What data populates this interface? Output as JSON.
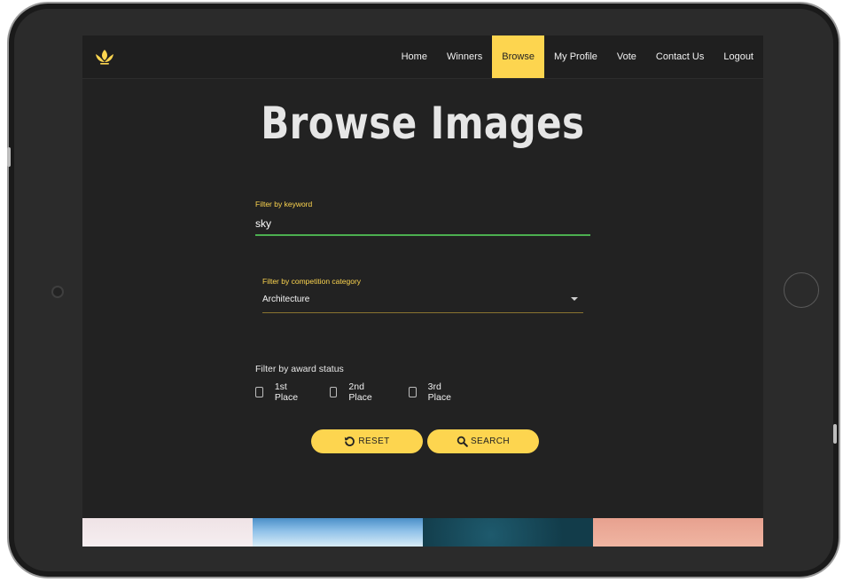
{
  "nav": {
    "logo_icon": "lotus-icon",
    "items": [
      "Home",
      "Winners",
      "Browse",
      "My Profile",
      "Vote",
      "Contact Us",
      "Logout"
    ],
    "active": "Browse"
  },
  "page": {
    "title": "Browse Images"
  },
  "filters": {
    "keyword": {
      "label": "Filter by keyword",
      "value": "sky"
    },
    "category": {
      "label": "Filter by competition category",
      "value": "Architecture"
    },
    "award": {
      "label": "Filter by award status",
      "options": [
        {
          "label": "1st Place",
          "checked": false
        },
        {
          "label": "2nd Place",
          "checked": false
        },
        {
          "label": "3rd Place",
          "checked": false
        }
      ]
    }
  },
  "actions": {
    "reset": {
      "label": "RESET",
      "icon": "reset-icon"
    },
    "search": {
      "label": "SEARCH",
      "icon": "search-icon"
    }
  },
  "colors": {
    "accent": "#fdd54f",
    "background": "#222222",
    "focus_underline": "#4caf50"
  }
}
